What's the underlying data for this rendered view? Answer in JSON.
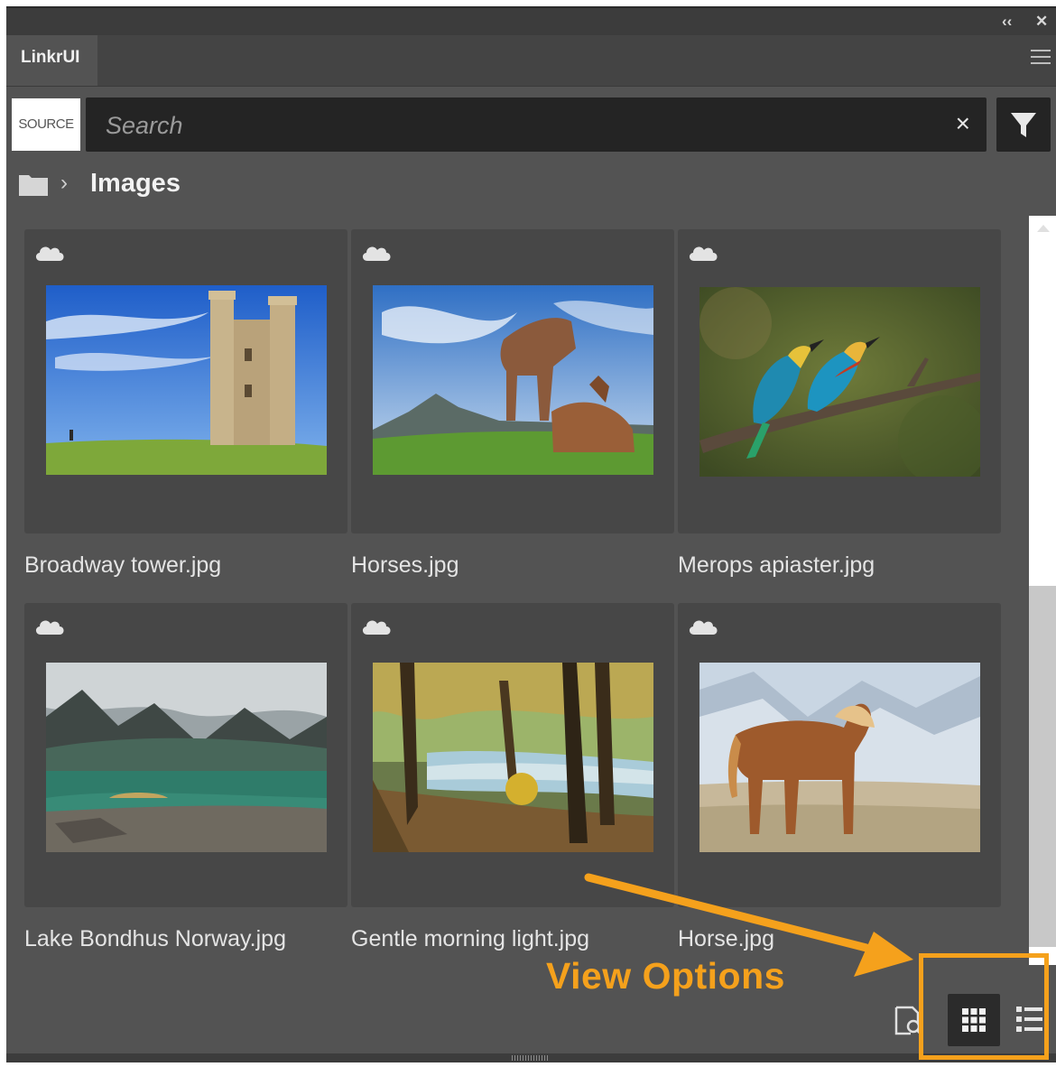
{
  "window": {
    "controls": [
      "collapse-icon",
      "close-icon"
    ],
    "tab_label": "LinkrUI",
    "menu_icon": "hamburger-icon"
  },
  "toolbar": {
    "source_label": "SOURCE",
    "search_placeholder": "Search",
    "search_value": "",
    "clear_icon": "close-icon",
    "clear_glyph": "×",
    "filter_icon": "filter-icon"
  },
  "breadcrumb": {
    "folder_icon": "folder-icon",
    "separator": "›",
    "current": "Images"
  },
  "assets": [
    {
      "filename": "Broadway tower.jpg",
      "cloud_icon": "cloud-icon"
    },
    {
      "filename": "Horses.jpg",
      "cloud_icon": "cloud-icon"
    },
    {
      "filename": "Merops apiaster.jpg",
      "cloud_icon": "cloud-icon"
    },
    {
      "filename": "Lake Bondhus Norway.jpg",
      "cloud_icon": "cloud-icon"
    },
    {
      "filename": "Gentle morning light.jpg",
      "cloud_icon": "cloud-icon"
    },
    {
      "filename": "Horse.jpg",
      "cloud_icon": "cloud-icon"
    }
  ],
  "footer": {
    "annotation": "View Options",
    "annotation_color": "#f5a11c",
    "buttons": [
      "preview-icon",
      "grid-view-icon",
      "list-view-icon"
    ],
    "active_view": "grid"
  }
}
